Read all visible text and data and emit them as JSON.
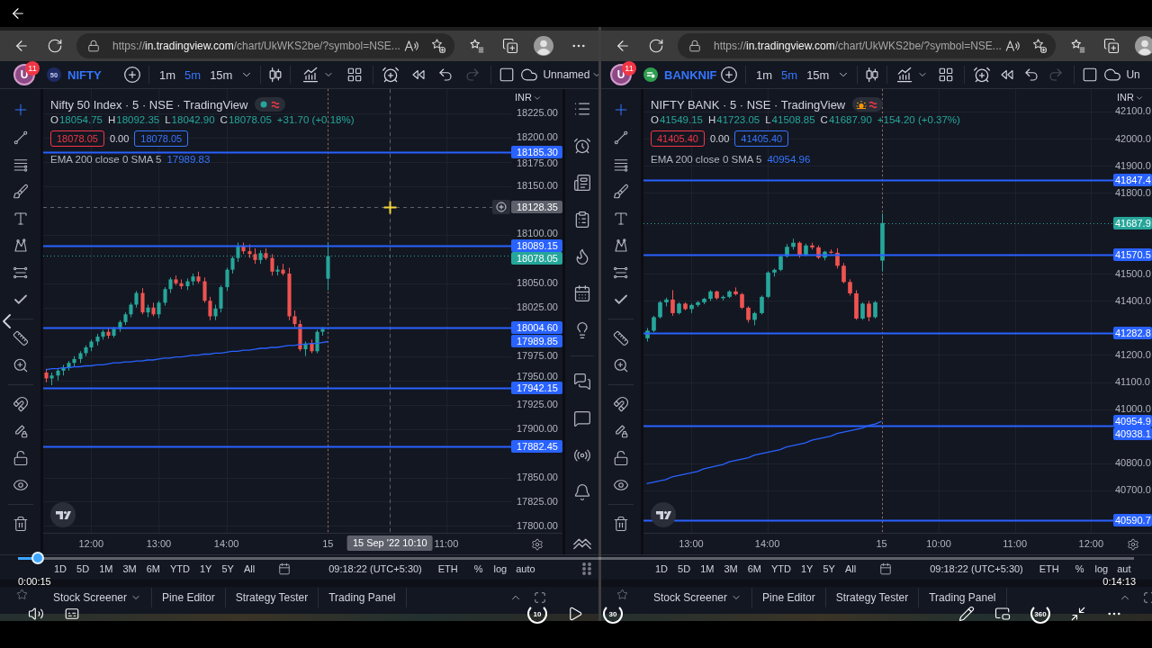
{
  "player": {
    "elapsed": "0:00:15",
    "duration": "0:14:13",
    "progress": {
      "level": 0.018
    },
    "skip_back": "10",
    "skip_forward": "30",
    "view_360": "360"
  },
  "windows": [
    {
      "browser": {
        "url": {
          "scheme": "https://",
          "host": "in.tradingview.com",
          "path": "/chart/UkWKS2be/?symbol=NSE..."
        }
      },
      "header": {
        "avatar": "U",
        "notifications": "11",
        "symbol": {
          "logo": {
            "kind": "text",
            "text": "50"
          },
          "name": "NIFTY"
        },
        "intervals": [
          {
            "label": "1m",
            "selected": false
          },
          {
            "label": "5m",
            "selected": true
          },
          {
            "label": "15m",
            "selected": false
          }
        ],
        "layout": "Unnamed"
      },
      "legend": {
        "title": "Nifty 50 Index · 5 · NSE · TradingView",
        "status": {
          "kind": "dot"
        },
        "ohlc": [
          {
            "key": "O",
            "value": "18054.75"
          },
          {
            "key": "H",
            "value": "18092.35"
          },
          {
            "key": "L",
            "value": "18042.90"
          },
          {
            "key": "C",
            "value": "18078.05"
          }
        ],
        "change": "+31.70 (+0.18%)",
        "sell": "18078.05",
        "spread": "0.00",
        "buy": "18078.05",
        "indicator": {
          "name": "EMA 200 close 0 SMA 5",
          "value": "17989.83"
        }
      },
      "currency": "INR",
      "chart_data": [
        {
          "type": "candlestick",
          "grid": true,
          "categories": [
            null,
            null,
            null,
            null,
            null,
            null,
            null,
            null,
            "12:00",
            null,
            null,
            null,
            null,
            null,
            null,
            null,
            null,
            null,
            null,
            null,
            "13:00",
            null,
            null,
            null,
            null,
            null,
            null,
            null,
            null,
            null,
            null,
            null,
            "14:00",
            null,
            null,
            null,
            null,
            null,
            null,
            null,
            null,
            null,
            null,
            null,
            null,
            null,
            null,
            null,
            null,
            null,
            "15",
            null,
            null,
            null,
            null,
            null,
            null,
            null,
            null,
            null,
            null,
            "15 Sep '22 10:10",
            null,
            null,
            null,
            null,
            null,
            null,
            null,
            null,
            null,
            "11:00",
            null,
            null,
            null,
            null,
            null,
            null,
            null,
            null,
            null,
            null,
            null
          ],
          "ylim": [
            17793,
            18250
          ],
          "yticks": [
            {
              "value": 18225,
              "label": "18225.00"
            },
            {
              "value": 18200,
              "label": "18200.00"
            },
            {
              "value": 18175,
              "label": "18175.00"
            },
            {
              "value": 18150,
              "label": "18150.00"
            },
            {
              "value": 18100,
              "label": "18100.00"
            },
            {
              "value": 18050,
              "label": "18050.00"
            },
            {
              "value": 18025,
              "label": "18025.00"
            },
            {
              "value": 17975,
              "label": "17975.00"
            },
            {
              "value": 17950,
              "label": "17950.00"
            },
            {
              "value": 17925,
              "label": "17925.00"
            },
            {
              "value": 17900,
              "label": "17900.00"
            },
            {
              "value": 17850,
              "label": "17850.00"
            },
            {
              "value": 17825,
              "label": "17825.00"
            },
            {
              "value": 17800,
              "label": "17800.00"
            }
          ],
          "series": [
            {
              "type": "candlestick",
              "ohlc": [
                [
                  17958,
                  17962,
                  17948,
                  17952
                ],
                [
                  17952,
                  17958,
                  17945,
                  17955
                ],
                [
                  17955,
                  17962,
                  17950,
                  17960
                ],
                [
                  17960,
                  17966,
                  17955,
                  17963
                ],
                [
                  17963,
                  17970,
                  17960,
                  17968
                ],
                [
                  17968,
                  17975,
                  17964,
                  17972
                ],
                [
                  17972,
                  17980,
                  17968,
                  17978
                ],
                [
                  17978,
                  17986,
                  17975,
                  17984
                ],
                [
                  17984,
                  17992,
                  17980,
                  17990
                ],
                [
                  17990,
                  17998,
                  17986,
                  17995
                ],
                [
                  17995,
                  18002,
                  17992,
                  18000
                ],
                [
                  18000,
                  18004,
                  17993,
                  17996
                ],
                [
                  17996,
                  18005,
                  17994,
                  18003
                ],
                [
                  18003,
                  18012,
                  18000,
                  18010
                ],
                [
                  18010,
                  18020,
                  18007,
                  18018
                ],
                [
                  18018,
                  18030,
                  18015,
                  18028
                ],
                [
                  18028,
                  18042,
                  18025,
                  18040
                ],
                [
                  18040,
                  18045,
                  18018,
                  18020
                ],
                [
                  18020,
                  18028,
                  18015,
                  18025
                ],
                [
                  18025,
                  18030,
                  18016,
                  18018
                ],
                [
                  18018,
                  18032,
                  18014,
                  18030
                ],
                [
                  18030,
                  18046,
                  18027,
                  18044
                ],
                [
                  18044,
                  18056,
                  18040,
                  18054
                ],
                [
                  18054,
                  18058,
                  18048,
                  18050
                ],
                [
                  18050,
                  18054,
                  18044,
                  18047
                ],
                [
                  18047,
                  18055,
                  18043,
                  18052
                ],
                [
                  18052,
                  18060,
                  18048,
                  18057
                ],
                [
                  18057,
                  18062,
                  18050,
                  18052
                ],
                [
                  18052,
                  18056,
                  18030,
                  18032
                ],
                [
                  18032,
                  18036,
                  18012,
                  18016
                ],
                [
                  18016,
                  18028,
                  18012,
                  18024
                ],
                [
                  18024,
                  18048,
                  18020,
                  18046
                ],
                [
                  18046,
                  18066,
                  18042,
                  18064
                ],
                [
                  18064,
                  18078,
                  18060,
                  18076
                ],
                [
                  18076,
                  18092,
                  18072,
                  18088
                ],
                [
                  18088,
                  18092,
                  18080,
                  18083
                ],
                [
                  18083,
                  18090,
                  18076,
                  18080
                ],
                [
                  18080,
                  18086,
                  18070,
                  18074
                ],
                [
                  18074,
                  18084,
                  18070,
                  18081
                ],
                [
                  18081,
                  18086,
                  18074,
                  18076
                ],
                [
                  18076,
                  18080,
                  18058,
                  18062
                ],
                [
                  18062,
                  18068,
                  18058,
                  18064
                ],
                [
                  18064,
                  18070,
                  18058,
                  18060
                ],
                [
                  18060,
                  18066,
                  18012,
                  18016
                ],
                [
                  18016,
                  18022,
                  18005,
                  18008
                ],
                [
                  18008,
                  18012,
                  17980,
                  17982
                ],
                [
                  17982,
                  17990,
                  17975,
                  17988
                ],
                [
                  17988,
                  17992,
                  17978,
                  17980
                ],
                [
                  17980,
                  18002,
                  17978,
                  18000
                ],
                [
                  18000,
                  18005,
                  17996,
                  18003
                ],
                [
                  18054.75,
                  18092.35,
                  18042.9,
                  18078.05
                ],
                null,
                null,
                null,
                null,
                null,
                null,
                null,
                null,
                null,
                null,
                null,
                null,
                null,
                null,
                null,
                null,
                null,
                null,
                null,
                null,
                null,
                null,
                null,
                null,
                null,
                null,
                null,
                null,
                null,
                null,
                null,
                null
              ]
            },
            {
              "type": "line",
              "color": "#2962ff",
              "values": [
                17961,
                17962,
                17962,
                17963,
                17963,
                17964,
                17964,
                17965,
                17965,
                17966,
                17966,
                17967,
                17968,
                17968,
                17969,
                17969,
                17970,
                17970,
                17971,
                17971,
                17972,
                17973,
                17973,
                17974,
                17974,
                17975,
                17976,
                17976,
                17977,
                17977,
                17978,
                17978,
                17979,
                17980,
                17980,
                17981,
                17981,
                17982,
                17983,
                17983,
                17984,
                17984,
                17985,
                17986,
                17986,
                17987,
                17987,
                17988,
                17988,
                17989,
                17990,
                null,
                null,
                null,
                null,
                null,
                null,
                null,
                null,
                null,
                null,
                null,
                null,
                null,
                null,
                null,
                null,
                null,
                null,
                null,
                null,
                null,
                null,
                null,
                null,
                null,
                null,
                null,
                null,
                null,
                null,
                null,
                null
              ]
            }
          ],
          "ref_lines": [
            {
              "axis": "y",
              "value": 18185.3,
              "label": "18185.30",
              "color": "#2962ff",
              "line_style": "solid"
            },
            {
              "axis": "y",
              "value": 18128.35,
              "label": "18128.35",
              "color": "#5d606b",
              "line_style": "dashed"
            },
            {
              "axis": "y",
              "value": 18089.15,
              "label": "18089.15",
              "color": "#2962ff",
              "line_style": "solid"
            },
            {
              "axis": "y",
              "value": 18078.05,
              "label": "18078.05",
              "color": "#26a69a",
              "line_style": "dotted"
            },
            {
              "axis": "y",
              "value": 18004.6,
              "label": "18004.60",
              "color": "#2962ff",
              "line_style": "solid"
            },
            {
              "axis": "y",
              "value": 17942.15,
              "label": "17942.15",
              "color": "#2962ff",
              "line_style": "solid"
            },
            {
              "axis": "y",
              "value": 17882.45,
              "label": "17882.45",
              "color": "#2962ff",
              "line_style": "solid"
            },
            {
              "axis": "x",
              "value": "15",
              "color": "#9c6b4e",
              "line_style": "dotted"
            },
            {
              "axis": "x",
              "value": "15 Sep '22 10:10",
              "color": "#5d606b",
              "line_style": "dashed"
            }
          ],
          "annotations": [
            "17989.85"
          ]
        }
      ],
      "range_bar": {
        "ranges": [
          "1D",
          "5D",
          "1M",
          "3M",
          "6M",
          "YTD",
          "1Y",
          "5Y",
          "All"
        ],
        "clock": "09:18:22 (UTC+5:30)",
        "options": [
          "ETH",
          "%",
          "log",
          "auto"
        ]
      },
      "bottom_tabs": [
        {
          "label": "Stock Screener",
          "dropdown": true
        },
        {
          "label": "Pine Editor",
          "dropdown": false
        },
        {
          "label": "Strategy Tester",
          "dropdown": false
        },
        {
          "label": "Trading Panel",
          "dropdown": false
        }
      ]
    },
    {
      "browser": {
        "url": {
          "scheme": "https://",
          "host": "in.tradingview.com",
          "path": "/chart/UkWKS2be/?symbol=NSE..."
        }
      },
      "header": {
        "avatar": "U",
        "notifications": "11",
        "symbol": {
          "logo": {
            "kind": "emblem"
          },
          "name": "BANKNIF"
        },
        "intervals": [
          {
            "label": "1m",
            "selected": false
          },
          {
            "label": "5m",
            "selected": true
          },
          {
            "label": "15m",
            "selected": false
          }
        ],
        "layout": "Un"
      },
      "legend": {
        "title": "NIFTY BANK · 5 · NSE · TradingView",
        "status": {
          "kind": "sun"
        },
        "ohlc": [
          {
            "key": "O",
            "value": "41549.15"
          },
          {
            "key": "H",
            "value": "41723.05"
          },
          {
            "key": "L",
            "value": "41508.85"
          },
          {
            "key": "C",
            "value": "41687.90"
          }
        ],
        "change": "+154.20 (+0.37%)",
        "sell": "41405.40",
        "spread": "0.00",
        "buy": "41405.40",
        "indicator": {
          "name": "EMA 200 close 0 SMA 5",
          "value": "40954.96"
        }
      },
      "currency": "INR",
      "chart_data": [
        {
          "type": "candlestick",
          "grid": true,
          "categories": [
            null,
            null,
            null,
            null,
            null,
            null,
            null,
            "13:00",
            null,
            null,
            null,
            null,
            null,
            null,
            null,
            null,
            null,
            null,
            null,
            "14:00",
            null,
            null,
            null,
            null,
            null,
            null,
            null,
            null,
            null,
            null,
            null,
            null,
            null,
            null,
            null,
            null,
            null,
            "15",
            null,
            null,
            null,
            null,
            null,
            null,
            null,
            null,
            "10:00",
            null,
            null,
            null,
            null,
            null,
            null,
            null,
            null,
            null,
            null,
            null,
            "11:00",
            null,
            null,
            null,
            null,
            null,
            null,
            null,
            null,
            null,
            null,
            null,
            "12:00",
            null,
            null,
            null
          ],
          "ylim": [
            40543,
            42183
          ],
          "yticks": [
            {
              "value": 42100,
              "label": "42100.0"
            },
            {
              "value": 42000,
              "label": "42000.0"
            },
            {
              "value": 41900,
              "label": "41900.0"
            },
            {
              "value": 41800,
              "label": "41800.0"
            },
            {
              "value": 41500,
              "label": "41500.0"
            },
            {
              "value": 41400,
              "label": "41400.0"
            },
            {
              "value": 41200,
              "label": "41200.0"
            },
            {
              "value": 41100,
              "label": "41100.0"
            },
            {
              "value": 41000,
              "label": "41000.0"
            },
            {
              "value": 40800,
              "label": "40800.0"
            },
            {
              "value": 40700,
              "label": "40700.0"
            }
          ],
          "series": [
            {
              "type": "candlestick",
              "ohlc": [
                [
                  41262,
                  41300,
                  41250,
                  41290
                ],
                [
                  41290,
                  41345,
                  41285,
                  41340
                ],
                [
                  41340,
                  41400,
                  41335,
                  41395
                ],
                [
                  41395,
                  41412,
                  41380,
                  41405
                ],
                [
                  41405,
                  41440,
                  41345,
                  41355
                ],
                [
                  41355,
                  41395,
                  41350,
                  41390
                ],
                [
                  41390,
                  41395,
                  41365,
                  41370
                ],
                [
                  41370,
                  41390,
                  41355,
                  41385
                ],
                [
                  41385,
                  41400,
                  41378,
                  41395
                ],
                [
                  41395,
                  41412,
                  41388,
                  41408
                ],
                [
                  41408,
                  41440,
                  41400,
                  41435
                ],
                [
                  41435,
                  41438,
                  41405,
                  41410
                ],
                [
                  41410,
                  41420,
                  41402,
                  41415
                ],
                [
                  41415,
                  41440,
                  41410,
                  41435
                ],
                [
                  41435,
                  41450,
                  41420,
                  41425
                ],
                [
                  41425,
                  41430,
                  41370,
                  41375
                ],
                [
                  41375,
                  41380,
                  41320,
                  41330
                ],
                [
                  41330,
                  41360,
                  41310,
                  41355
                ],
                [
                  41355,
                  41420,
                  41350,
                  41415
                ],
                [
                  41415,
                  41510,
                  41410,
                  41505
                ],
                [
                  41505,
                  41520,
                  41490,
                  41515
                ],
                [
                  41515,
                  41570,
                  41510,
                  41565
                ],
                [
                  41565,
                  41610,
                  41560,
                  41600
                ],
                [
                  41600,
                  41630,
                  41590,
                  41615
                ],
                [
                  41615,
                  41620,
                  41560,
                  41570
                ],
                [
                  41570,
                  41612,
                  41565,
                  41605
                ],
                [
                  41605,
                  41615,
                  41590,
                  41598
                ],
                [
                  41598,
                  41605,
                  41555,
                  41560
                ],
                [
                  41560,
                  41585,
                  41550,
                  41582
                ],
                [
                  41582,
                  41590,
                  41575,
                  41578
                ],
                [
                  41578,
                  41595,
                  41520,
                  41530
                ],
                [
                  41530,
                  41540,
                  41465,
                  41470
                ],
                [
                  41470,
                  41480,
                  41420,
                  41428
                ],
                [
                  41428,
                  41440,
                  41330,
                  41335
                ],
                [
                  41335,
                  41395,
                  41330,
                  41390
                ],
                [
                  41390,
                  41400,
                  41325,
                  41340
                ],
                [
                  41340,
                  41400,
                  41335,
                  41395
                ],
                [
                  41549.15,
                  41723.05,
                  41508.85,
                  41687.9
                ],
                null,
                null,
                null,
                null,
                null,
                null,
                null,
                null,
                null,
                null,
                null,
                null,
                null,
                null,
                null,
                null,
                null,
                null,
                null,
                null,
                null,
                null,
                null,
                null,
                null,
                null,
                null,
                null,
                null,
                null,
                null,
                null,
                null,
                null,
                null,
                null
              ]
            },
            {
              "type": "line",
              "color": "#2962ff",
              "values": [
                40725,
                40730,
                40735,
                40740,
                40750,
                40755,
                40760,
                40765,
                40770,
                40780,
                40785,
                40790,
                40795,
                40805,
                40810,
                40815,
                40820,
                40830,
                40835,
                40840,
                40845,
                40850,
                40860,
                40865,
                40870,
                40875,
                40885,
                40890,
                40895,
                40900,
                40910,
                40915,
                40920,
                40925,
                40930,
                40940,
                40945,
                40955,
                null,
                null,
                null,
                null,
                null,
                null,
                null,
                null,
                null,
                null,
                null,
                null,
                null,
                null,
                null,
                null,
                null,
                null,
                null,
                null,
                null,
                null,
                null,
                null,
                null,
                null,
                null,
                null,
                null,
                null,
                null,
                null,
                null,
                null,
                null,
                null
              ]
            }
          ],
          "ref_lines": [
            {
              "axis": "y",
              "value": 41847.4,
              "label": "41847.4",
              "color": "#2962ff",
              "line_style": "solid"
            },
            {
              "axis": "y",
              "value": 41687.9,
              "label": "41687.9",
              "color": "#26a69a",
              "line_style": "dotted"
            },
            {
              "axis": "y",
              "value": 41570.5,
              "label": "41570.5",
              "color": "#2962ff",
              "line_style": "solid"
            },
            {
              "axis": "y",
              "value": 41282.8,
              "label": "41282.8",
              "color": "#2962ff",
              "line_style": "solid"
            },
            {
              "axis": "y",
              "value": 40938.1,
              "label": "40938.1",
              "color": "#2962ff",
              "line_style": "solid"
            },
            {
              "axis": "y",
              "value": 40590.7,
              "label": "40590.7",
              "color": "#2962ff",
              "line_style": "solid"
            },
            {
              "axis": "x",
              "value": "15",
              "color": "#9c6b4e",
              "line_style": "dotted"
            }
          ],
          "annotations": [
            "40954.9"
          ]
        }
      ],
      "range_bar": {
        "ranges": [
          "1D",
          "5D",
          "1M",
          "3M",
          "6M",
          "YTD",
          "1Y",
          "5Y",
          "All"
        ],
        "clock": "09:18:22 (UTC+5:30)",
        "options": [
          "ETH",
          "%",
          "log",
          "aut"
        ]
      },
      "bottom_tabs": [
        {
          "label": "Stock Screener",
          "dropdown": true
        },
        {
          "label": "Pine Editor",
          "dropdown": false
        },
        {
          "label": "Strategy Tester",
          "dropdown": false
        },
        {
          "label": "Trading Panel",
          "dropdown": false
        }
      ]
    }
  ]
}
